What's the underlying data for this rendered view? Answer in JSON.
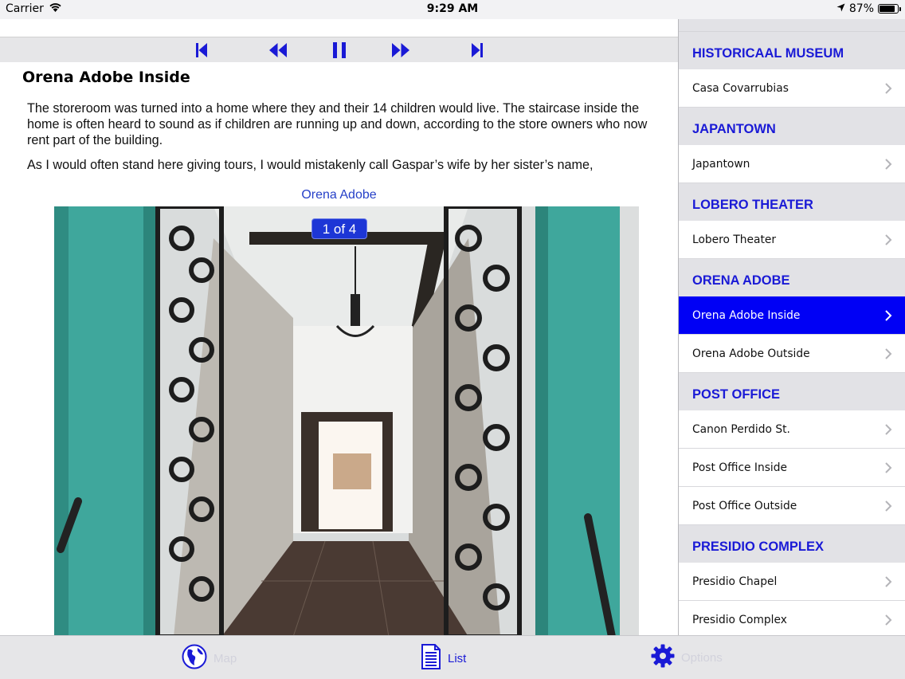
{
  "status_bar": {
    "carrier": "Carrier",
    "time": "9:29 AM",
    "battery": "87%",
    "battery_level": 0.87
  },
  "media_controls": [
    "skip-to-start-icon",
    "rewind-icon",
    "pause-icon",
    "fast-forward-icon",
    "skip-to-end-icon"
  ],
  "article": {
    "title": "Orena Adobe Inside",
    "paragraphs": [
      "The storeroom was turned into a home where they and their 14 children would live. The staircase inside the home is often heard to sound as if children are running up and down, according to the store owners who now rent part of the building.",
      "As I would often stand here giving tours, I would mistakenly call Gaspar’s wife by her sister’s name,"
    ],
    "image_caption": "Orena Adobe",
    "image_counter": "1 of 4"
  },
  "sidebar": {
    "sections": [
      {
        "header": "HISTORICAAL MUSEUM",
        "items": [
          {
            "label": "Casa Covarrubias",
            "selected": false
          }
        ]
      },
      {
        "header": "JAPANTOWN",
        "items": [
          {
            "label": "Japantown",
            "selected": false
          }
        ]
      },
      {
        "header": "LOBERO THEATER",
        "items": [
          {
            "label": "Lobero Theater",
            "selected": false
          }
        ]
      },
      {
        "header": "ORENA ADOBE",
        "items": [
          {
            "label": "Orena Adobe Inside",
            "selected": true
          },
          {
            "label": "Orena Adobe Outside",
            "selected": false
          }
        ]
      },
      {
        "header": "POST OFFICE",
        "items": [
          {
            "label": "Canon Perdido St.",
            "selected": false
          },
          {
            "label": "Post Office Inside",
            "selected": false
          },
          {
            "label": "Post Office Outside",
            "selected": false
          }
        ]
      },
      {
        "header": "PRESIDIO COMPLEX",
        "items": [
          {
            "label": "Presidio Chapel",
            "selected": false
          },
          {
            "label": "Presidio Complex",
            "selected": false
          }
        ]
      }
    ]
  },
  "tab_bar": {
    "tabs": [
      {
        "label": "Map",
        "icon": "globe-icon",
        "active": false
      },
      {
        "label": "List",
        "icon": "document-list-icon",
        "active": true
      },
      {
        "label": "Options",
        "icon": "gear-icon",
        "active": false
      }
    ]
  },
  "colors": {
    "accent_blue": "#1a1ad6",
    "selected_row": "#0000f5",
    "counter_badge": "#1d36d6"
  }
}
